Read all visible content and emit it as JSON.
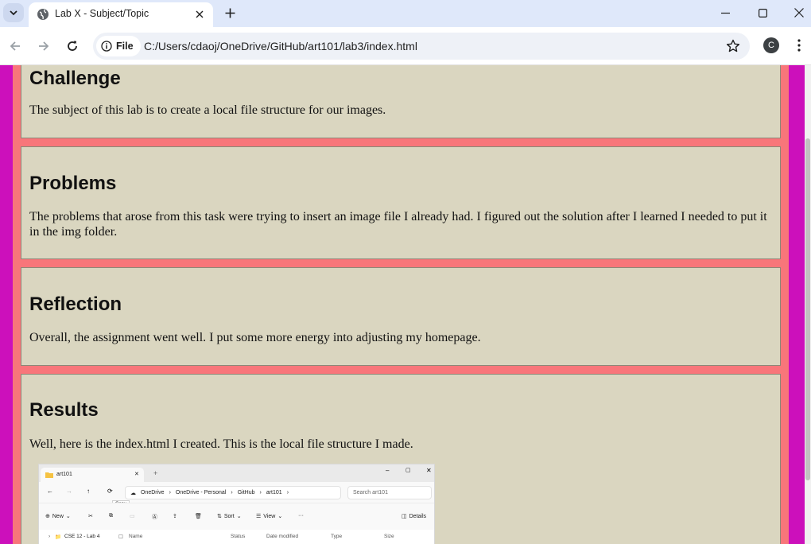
{
  "browser": {
    "tab_title": "Lab X - Subject/Topic",
    "chip_label": "File",
    "url": "C:/Users/cdaoj/OneDrive/GitHub/art101/lab3/index.html",
    "profile_initial": "C"
  },
  "colors": {
    "outer_background": "#cc10bb",
    "page_background": "#f8767a",
    "section_background": "#dad6c0"
  },
  "sections": [
    {
      "heading": "Challenge",
      "text": "The subject of this lab is to create a local file structure for our images."
    },
    {
      "heading": "Problems",
      "text": "The problems that arose from this task were trying to insert an image file I already had. I figured out the solution after I learned I needed to put it in the img folder."
    },
    {
      "heading": "Reflection",
      "text": "Overall, the assignment went well. I put some more energy into adjusting my homepage."
    },
    {
      "heading": "Results",
      "text": "Well, here is the index.html I created. This is the local file structure I made."
    }
  ],
  "screenshot": {
    "tab_title": "art101",
    "breadcrumbs": [
      "OneDrive",
      "OneDrive - Personal",
      "GitHub",
      "art101"
    ],
    "search_placeholder": "Search art101",
    "tooltip": "Copy",
    "commands": {
      "new": "New",
      "sort": "Sort",
      "view": "View",
      "details": "Details"
    },
    "columns": [
      "Name",
      "Status",
      "Date modified",
      "Type",
      "Size"
    ],
    "first_row": "CSE 12 - Lab 4"
  }
}
